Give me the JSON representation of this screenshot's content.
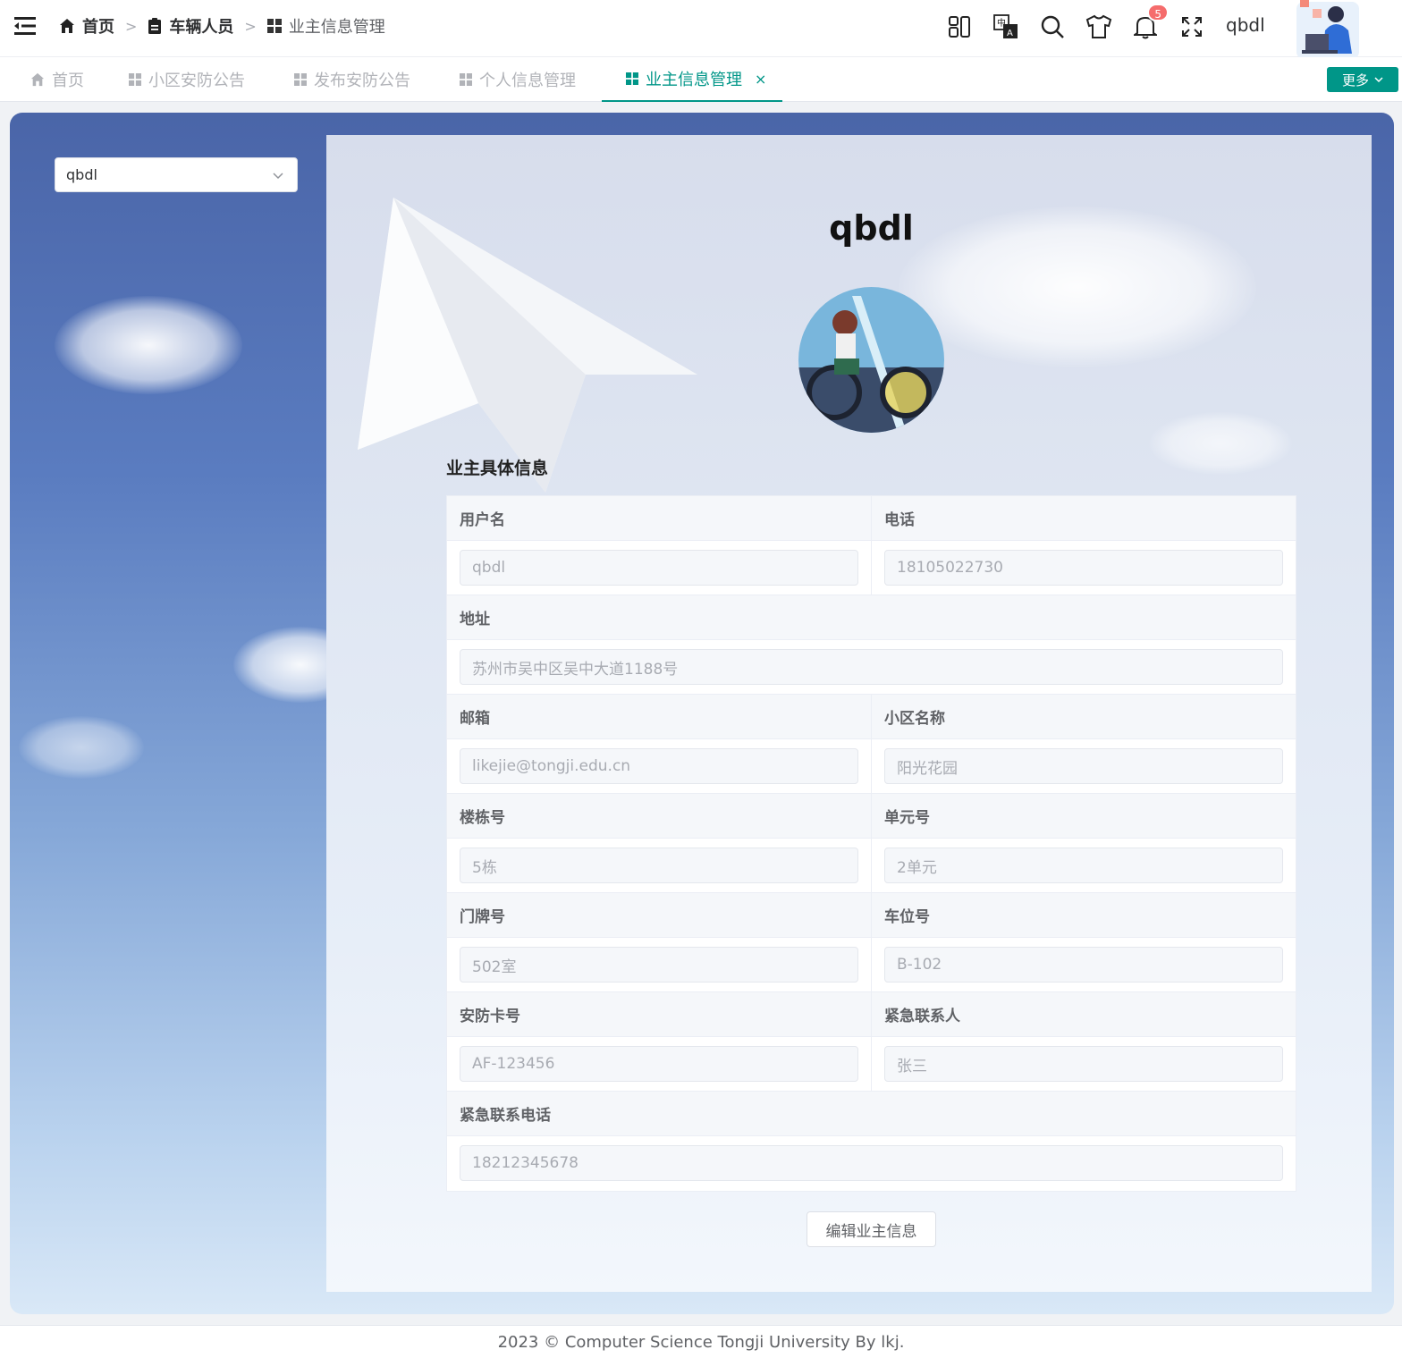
{
  "header": {
    "breadcrumb": [
      {
        "label": "首页",
        "icon": "home-icon"
      },
      {
        "label": "车辆人员",
        "icon": "clipboard-icon"
      },
      {
        "label": "业主信息管理",
        "icon": "grid-icon"
      }
    ],
    "notification_count": "5",
    "username": "qbdl"
  },
  "tabs": [
    {
      "label": "首页",
      "icon": "home-icon"
    },
    {
      "label": "小区安防公告",
      "icon": "grid-icon"
    },
    {
      "label": "发布安防公告",
      "icon": "grid-icon"
    },
    {
      "label": "个人信息管理",
      "icon": "grid-icon"
    },
    {
      "label": "业主信息管理",
      "icon": "grid-icon",
      "active": true,
      "close": "×"
    }
  ],
  "more_label": "更多",
  "selector": {
    "value": "qbdl"
  },
  "profile": {
    "name": "qbdl",
    "section_title": "业主具体信息",
    "fields": {
      "username": {
        "label": "用户名",
        "value": "qbdl"
      },
      "phone": {
        "label": "电话",
        "value": "18105022730"
      },
      "address": {
        "label": "地址",
        "value": "苏州市吴中区吴中大道1188号"
      },
      "email": {
        "label": "邮箱",
        "value": "likejie@tongji.edu.cn"
      },
      "community": {
        "label": "小区名称",
        "value": "阳光花园"
      },
      "building": {
        "label": "楼栋号",
        "value": "5栋"
      },
      "unit": {
        "label": "单元号",
        "value": "2单元"
      },
      "door": {
        "label": "门牌号",
        "value": "502室"
      },
      "parking": {
        "label": "车位号",
        "value": "B-102"
      },
      "card": {
        "label": "安防卡号",
        "value": "AF-123456"
      },
      "contact": {
        "label": "紧急联系人",
        "value": "张三"
      },
      "contact_phone": {
        "label": "紧急联系电话",
        "value": "18212345678"
      }
    },
    "edit_label": "编辑业主信息"
  },
  "footer": "2023 © Computer Science Tongji University By lkj.",
  "colors": {
    "accent": "#009688",
    "badge": "#f56c6c"
  }
}
